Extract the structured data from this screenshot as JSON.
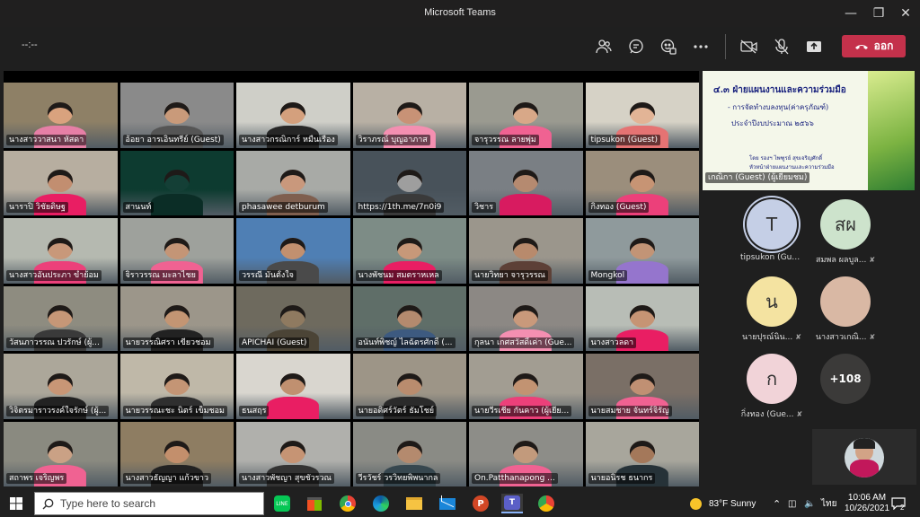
{
  "window": {
    "title": "Microsoft Teams"
  },
  "toolbar": {
    "timer": "--:--",
    "leave_label": "ออก"
  },
  "slide": {
    "line1": "๔.๓  ฝ่ายแผนงานและความร่วมมือ",
    "line2": "-  การจัดทำงบลงทุน(ค่าครุภัณฑ์)",
    "line3": "ประจำปีงบประมาณ ๒๕๖๖",
    "line4": "โดย  รองฯ ไพฑูรย์  สุขเจริญศักดิ์",
    "line5": "หัวหน้าฝ่ายแผนงานและความร่วมมือ",
    "presenter": "เกณิกา (Guest) (ผู้เยี่ยมชม)"
  },
  "participants": [
    {
      "name": "นางสาววาสนา  หัสดา",
      "bg": "#8e8066",
      "skin": "#d9a27e",
      "shirt": "#e67fa6"
    },
    {
      "name": "อ้อยา อารเอินทรีย์ (Guest)",
      "bg": "#8a8a8a",
      "skin": "#c99a7a",
      "shirt": "#555555"
    },
    {
      "name": "นางสาวกรณิการ์  หมื่นเรือง",
      "bg": "#cfcfc8",
      "skin": "#d4a07d",
      "shirt": "#262626"
    },
    {
      "name": "วิราภรณ์  บุญอาภาส",
      "bg": "#b8b0a4",
      "skin": "#c89276",
      "shirt": "#f48fb1"
    },
    {
      "name": "จารุวรรณ ลายพุ่ม",
      "bg": "#9a9a90",
      "skin": "#d8a888",
      "shirt": "#f06292"
    },
    {
      "name": "tipsukon (Guest)",
      "bg": "#d6d2c6",
      "skin": "#e2b496",
      "shirt": "#e57373"
    },
    {
      "name": "นาราปิ  วิชัยดิษฐ",
      "bg": "#b7aea0",
      "skin": "#c28e70",
      "shirt": "#e91e63"
    },
    {
      "name": "สานนท์",
      "bg": "#0d3b30",
      "skin": "#143f36",
      "shirt": "#0b2d26"
    },
    {
      "name": "phasawee detburum",
      "bg": "#a8aaa6",
      "skin": "#c9987c",
      "shirt": "#7f5f4f"
    },
    {
      "name": "https://1th.me/7n0i9",
      "bg": "#48525a",
      "skin": "#9e9e9e",
      "shirt": "#3a3a3a"
    },
    {
      "name": "วิชาร",
      "bg": "#7a7f84",
      "skin": "#b58a70",
      "shirt": "#d81b60"
    },
    {
      "name": "กิ่งทอง (Guest)",
      "bg": "#9b8e7c",
      "skin": "#c79474",
      "shirt": "#ec407a"
    },
    {
      "name": "นางสาวอันประภา ขำย้อม",
      "bg": "#b5b9b0",
      "skin": "#c8987a",
      "shirt": "#ec407a"
    },
    {
      "name": "จิราวรรณ มะลาไชย",
      "bg": "#9ea19c",
      "skin": "#c49576",
      "shirt": "#f06292"
    },
    {
      "name": "วรรณี  มั่นตั้งใจ",
      "bg": "#4f7fb4",
      "skin": "#c2906f",
      "shirt": "#4a4a4a"
    },
    {
      "name": "นางพัชนม  สมตราหเหล",
      "bg": "#7d8c86",
      "skin": "#c79879",
      "shirt": "#e91e63"
    },
    {
      "name": "นายวิทยา  จารุวรรณ",
      "bg": "#9b968c",
      "skin": "#b88a6c",
      "shirt": "#5d4037"
    },
    {
      "name": "Mongkol",
      "bg": "#8f9a9c",
      "skin": "#c29476",
      "shirt": "#9575cd"
    },
    {
      "name": "วัสนภาวรรณ ปวรักษ์ (ผู้...",
      "bg": "#8e8c80",
      "skin": "#c69777",
      "shirt": "#3a3a3a"
    },
    {
      "name": "นายวรรณิศรา  เขียวชอม",
      "bg": "#9c968a",
      "skin": "#c39573",
      "shirt": "#222222"
    },
    {
      "name": "APICHAI (Guest)",
      "bg": "#6e6a5e",
      "skin": "#8f7a60",
      "shirt": "#4b4436"
    },
    {
      "name": "อนันท์พิชญ์  ไลฉัตรศักดิ์ (...",
      "bg": "#5f6e68",
      "skin": "#b48a6e",
      "shirt": "#3d5a80"
    },
    {
      "name": "กุลนา เกศสวัสดิ์เค่า (Gue...",
      "bg": "#8c8884",
      "skin": "#c9997b",
      "shirt": "#f48fb1"
    },
    {
      "name": "นางสาวลดา",
      "bg": "#b8bdb6",
      "skin": "#c69474",
      "shirt": "#e91e63"
    },
    {
      "name": "วิจิตรมาราวรงค์ใจรักษ์ (ผู้...",
      "bg": "#aca79a",
      "skin": "#c89676",
      "shirt": "#222222"
    },
    {
      "name": "นายวรรณะชะ นิตร์ เข็มชอม",
      "bg": "#bfb8a8",
      "skin": "#c49575",
      "shirt": "#2f2f2f"
    },
    {
      "name": "ธนสฤร",
      "bg": "#d9d6cf",
      "skin": "#c09070",
      "shirt": "#e91e63"
    },
    {
      "name": "นายอดิศร์วัตร์  ธัมโชย์",
      "bg": "#9d9587",
      "skin": "#b98c6e",
      "shirt": "#2b2b2b"
    },
    {
      "name": "นายวีรเชีย กันคาว (ผู้เยีย...",
      "bg": "#a29d92",
      "skin": "#c29372",
      "shirt": "#ec407a"
    },
    {
      "name": "นายสมชาย  จันทร์จิรัญ",
      "bg": "#7a6f66",
      "skin": "#c09073",
      "shirt": "#f06292"
    },
    {
      "name": "สถาพร เจริญพร",
      "bg": "#8a8a80",
      "skin": "#caa185",
      "shirt": "#f06292"
    },
    {
      "name": "นางสาวธัญญา แก้วขาว",
      "bg": "#8e7d62",
      "skin": "#c38f6c",
      "shirt": "#222222"
    },
    {
      "name": "นางสาวพัชญา  สุขชัวรวณ",
      "bg": "#b0b0ac",
      "skin": "#c69474",
      "shirt": "#333333"
    },
    {
      "name": "วีรวัชร์ วรวิทยพิพนากล",
      "bg": "#8a8b85",
      "skin": "#b48a6e",
      "shirt": "#37474f"
    },
    {
      "name": "On.Patthanapong ...",
      "bg": "#8d8d88",
      "skin": "#c29a7c",
      "shirt": "#f06292"
    },
    {
      "name": "นายอนิรช  ธนากร",
      "bg": "#a8a69c",
      "skin": "#a4785a",
      "shirt": "#263238"
    }
  ],
  "roster": [
    {
      "initials": "T",
      "name": "tipsukon (Guest...",
      "color": "#c5cfe6",
      "mic": ""
    },
    {
      "initials": "สผ",
      "name": "สมพล ผลบูล...",
      "color": "#cde3cc",
      "mic": "🎙"
    },
    {
      "initials": "น",
      "name": "นายปุรณ์นิน...",
      "color": "#f4e3a1",
      "mic": "🎙"
    },
    {
      "initials": "",
      "name": "นางสาวเกณิ...",
      "color": "#d9b8a4",
      "mic": "🎙"
    },
    {
      "initials": "ก",
      "name": "กิ่งทอง (Gue...",
      "color": "#f1d3d8",
      "mic": "🎙"
    },
    {
      "initials": "+108",
      "name": "",
      "color": "#3b3a39",
      "mic": ""
    }
  ],
  "taskbar": {
    "search_placeholder": "Type here to search",
    "weather": "83°F  Sunny",
    "lang": "ไทย",
    "time": "10:06 AM",
    "date": "10/26/2021",
    "notif_count": "2"
  }
}
